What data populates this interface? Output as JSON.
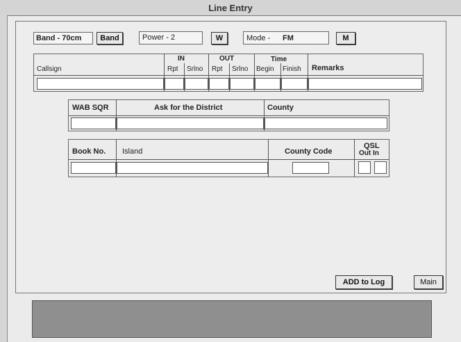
{
  "window": {
    "title": "Line Entry"
  },
  "controls": {
    "band_label": "Band - 70cm",
    "band_button": "Band",
    "power_label": "Power - 2",
    "power_button": "W",
    "mode_label": "Mode -",
    "mode_value": "FM",
    "mode_button": "M"
  },
  "log_table": {
    "callsign": "Callsign",
    "in": "IN",
    "out": "OUT",
    "time": "Time",
    "rpt": "Rpt",
    "srlno": "Srlno",
    "begin": "Begin",
    "finish": "Finish",
    "remarks": "Remarks"
  },
  "wab_table": {
    "wab_sqr": "WAB SQR",
    "district": "Ask for the District",
    "county": "County"
  },
  "book_table": {
    "book_no": "Book No.",
    "island": "Island",
    "county_code": "County Code",
    "qsl": "QSL",
    "out_in": "Out In"
  },
  "actions": {
    "add_to_log": "ADD to Log",
    "main": "Main"
  }
}
